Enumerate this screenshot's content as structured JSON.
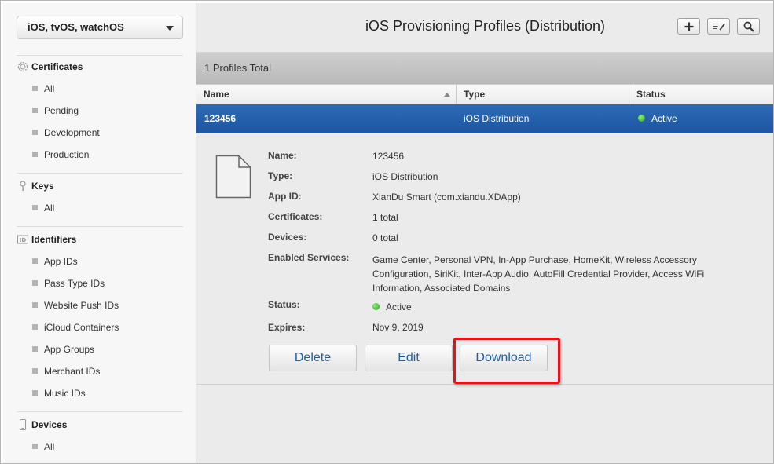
{
  "sidebar": {
    "platform_select": "iOS, tvOS, watchOS",
    "sections": [
      {
        "title": "Certificates",
        "icon": "certificate-icon",
        "items": [
          "All",
          "Pending",
          "Development",
          "Production"
        ]
      },
      {
        "title": "Keys",
        "icon": "key-icon",
        "items": [
          "All"
        ]
      },
      {
        "title": "Identifiers",
        "icon": "id-badge-icon",
        "items": [
          "App IDs",
          "Pass Type IDs",
          "Website Push IDs",
          "iCloud Containers",
          "App Groups",
          "Merchant IDs",
          "Music IDs"
        ]
      },
      {
        "title": "Devices",
        "icon": "device-icon",
        "items": [
          "All"
        ]
      }
    ]
  },
  "header": {
    "title": "iOS Provisioning Profiles (Distribution)",
    "toolbar_icons": [
      "add-icon",
      "edit-icon",
      "search-icon"
    ]
  },
  "list": {
    "total_label": "1 Profiles Total",
    "columns": [
      "Name",
      "Type",
      "Status"
    ],
    "rows": [
      {
        "name": "123456",
        "type": "iOS Distribution",
        "status": "Active"
      }
    ]
  },
  "details": {
    "fields": [
      {
        "label": "Name:",
        "value": "123456"
      },
      {
        "label": "Type:",
        "value": "iOS Distribution"
      },
      {
        "label": "App ID:",
        "value": "XianDu Smart (com.xiandu.XDApp)"
      },
      {
        "label": "Certificates:",
        "value": "1 total"
      },
      {
        "label": "Devices:",
        "value": "0 total"
      },
      {
        "label": "Enabled Services:",
        "value": "Game Center, Personal VPN, In-App Purchase, HomeKit, Wireless Accessory Configuration, SiriKit, Inter-App Audio, AutoFill Credential Provider, Access WiFi Information, Associated Domains"
      },
      {
        "label": "Status:",
        "value": "Active"
      },
      {
        "label": "Expires:",
        "value": "Nov 9, 2019"
      }
    ],
    "buttons": {
      "delete": "Delete",
      "edit": "Edit",
      "download": "Download"
    }
  },
  "colors": {
    "selected_row": "#1d56a3",
    "link_blue": "#1f5ea8",
    "status_active": "#27a11a",
    "highlight_box": "#e0141a"
  }
}
